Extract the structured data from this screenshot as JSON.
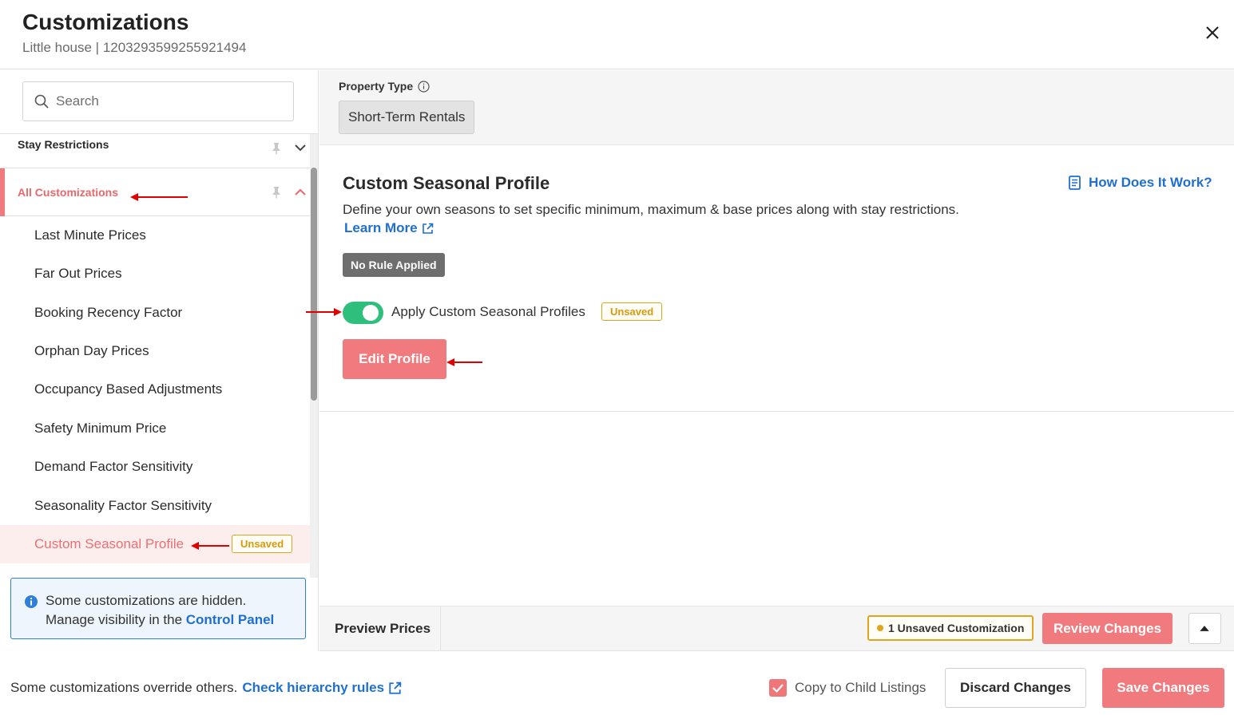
{
  "header": {
    "title": "Customizations",
    "subtitle": "Little house | 1203293599255921494",
    "close_icon": "close-icon"
  },
  "sidebar": {
    "search": {
      "placeholder": "Search",
      "value": ""
    },
    "sections": [
      {
        "label": "Stay Restrictions",
        "expanded": false
      },
      {
        "label": "All Customizations",
        "expanded": true,
        "active": true
      }
    ],
    "items": [
      {
        "label": "Last Minute Prices"
      },
      {
        "label": "Far Out Prices"
      },
      {
        "label": "Booking Recency Factor"
      },
      {
        "label": "Orphan Day Prices"
      },
      {
        "label": "Occupancy Based Adjustments"
      },
      {
        "label": "Safety Minimum Price"
      },
      {
        "label": "Demand Factor Sensitivity"
      },
      {
        "label": "Seasonality Factor Sensitivity"
      },
      {
        "label": "Custom Seasonal Profile",
        "active": true,
        "badge": "Unsaved"
      }
    ],
    "info": {
      "line1": "Some customizations are hidden.",
      "line2_prefix": "Manage visibility in the ",
      "link": "Control Panel"
    }
  },
  "property_type": {
    "label": "Property Type",
    "value": "Short-Term Rentals"
  },
  "main": {
    "title": "Custom Seasonal Profile",
    "how_link": "How Does It Work?",
    "description": "Define your own seasons to set specific minimum, maximum & base prices along with stay restrictions.",
    "learn_more": "Learn More",
    "status_chip": "No Rule Applied",
    "toggle": {
      "label": "Apply Custom Seasonal Profiles",
      "on": true,
      "badge": "Unsaved"
    },
    "edit_button": "Edit Profile"
  },
  "preview_bar": {
    "tab": "Preview Prices",
    "unsaved_count": "1 Unsaved Customization",
    "review_button": "Review Changes"
  },
  "footer": {
    "note": "Some customizations override others.",
    "hierarchy_link": "Check hierarchy rules",
    "copy_label": "Copy to Child Listings",
    "copy_checked": true,
    "discard_button": "Discard Changes",
    "save_button": "Save Changes"
  },
  "colors": {
    "accent": "#f07a7d",
    "link": "#1f6fd1",
    "toggle_on": "#2fbf7d",
    "unsaved": "#e0a51e",
    "annotation_arrow": "#e00000"
  }
}
